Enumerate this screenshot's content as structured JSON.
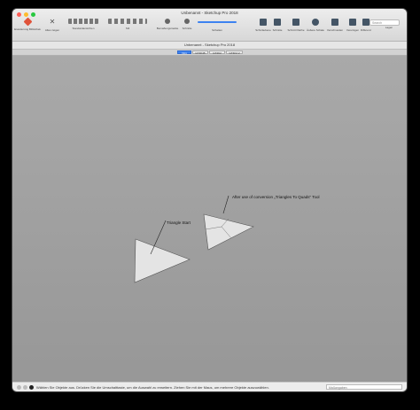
{
  "window": {
    "title": "Unbenannt - Sketchup Pro 2018",
    "document_title": "Unbenannt - Sketchup Pro 2018"
  },
  "toolbar": {
    "items": [
      {
        "label": "Erweiterung Bibliothek",
        "icon": "ruby-icon",
        "color": "#e0533a"
      },
      {
        "label": "Alles zeigen",
        "icon": "move-icon",
        "color": "#555555"
      },
      {
        "label": "Standardansichten",
        "icon": "views-icon",
        "color": "#666666"
      },
      {
        "label": "Stil",
        "icon": "style-icon",
        "color": "#666666"
      },
      {
        "label": "Bemaßungsmarke",
        "icon": "dimension-icon",
        "color": "#555555"
      },
      {
        "label": "Schnitte",
        "icon": "section-icon",
        "color": "#555555"
      },
      {
        "label": "Schatten",
        "icon": "shadow-icon",
        "color": "#3d82f0"
      },
      {
        "label": "Schnittebene",
        "icon": "section-plane-icon",
        "color": "#445566"
      },
      {
        "label": "Schnitte",
        "icon": "cut-icon",
        "color": "#445566"
      },
      {
        "label": "Schnitt Fläche",
        "icon": "section-face-icon",
        "color": "#445566"
      },
      {
        "label": "Äußere Schale",
        "icon": "outer-shell-icon",
        "color": "#445566"
      },
      {
        "label": "Verschneiden",
        "icon": "intersect-icon",
        "color": "#445566"
      },
      {
        "label": "Vereinigen",
        "icon": "union-icon",
        "color": "#445566"
      },
      {
        "label": "Differenz",
        "icon": "difference-icon",
        "color": "#445566"
      },
      {
        "label": "Lagen",
        "icon": "layers-icon",
        "color": "#445566"
      }
    ],
    "search_placeholder": "Search"
  },
  "page_tabs": [
    {
      "label": "Intro",
      "active": true
    },
    {
      "label": "GT4K45",
      "active": false
    },
    {
      "label": "GT4K2",
      "active": false
    },
    {
      "label": "GT4K2 2",
      "active": false
    }
  ],
  "scene": {
    "label_triangle_start": "Triangle Start",
    "label_after_use": "After use of conversion „Triangles To Quads“ Tool",
    "shape_fill": "#e4e4e4"
  },
  "statusbar": {
    "hint": "Wählen Sie Objekte aus. Drücken Sie die Umschalttaste, um die Auswahl zu erweitern. Ziehen Sie mit der Maus, um mehrere Objekte auszuwählen.",
    "measurements_label": "Maßangaben"
  }
}
